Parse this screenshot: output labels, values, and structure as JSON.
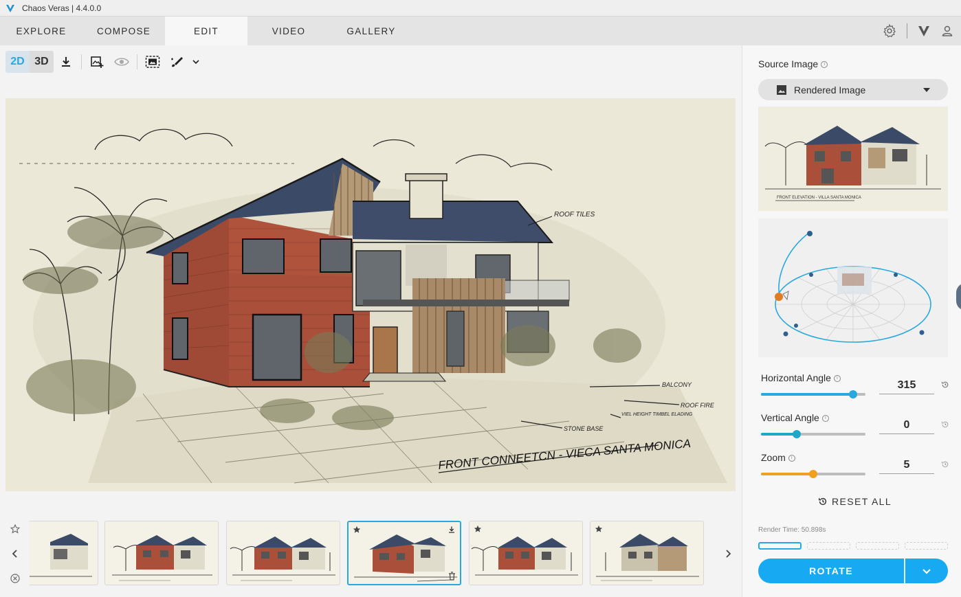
{
  "app": {
    "title": "Chaos Veras | 4.4.0.0"
  },
  "nav": {
    "tabs": [
      {
        "label": "EXPLORE"
      },
      {
        "label": "COMPOSE"
      },
      {
        "label": "EDIT",
        "active": true
      },
      {
        "label": "VIDEO"
      },
      {
        "label": "GALLERY"
      }
    ],
    "icons": [
      "gear-icon",
      "veras-logo-icon",
      "user-icon"
    ]
  },
  "toolbar": {
    "mode_2d": "2D",
    "mode_3d": "3D",
    "active_mode": "2D",
    "icons": [
      "download-icon",
      "add-image-icon",
      "eye-icon",
      "crop-image-icon",
      "brush-icon",
      "chevron-down-icon"
    ]
  },
  "canvas": {
    "annotations": {
      "roof_tiles": "ROOF TILES",
      "balcony": "BALCONY",
      "roof_fire": "ROOF FIRE",
      "stone_base": "STONE BASE",
      "vertical_timber": "VIEL HEIGHT TIMBEL ELADING",
      "caption": "FRONT CONNEETCN - VIECA SANTA MONICA"
    }
  },
  "thumbnails": {
    "count": 6,
    "selected_index": 3,
    "preview_caption": "FRONT ELEVATION - VILLA SANTA MONICA"
  },
  "panel": {
    "source_image_label": "Source Image",
    "source_image_value": "Rendered Image",
    "horizontal_angle": {
      "label": "Horizontal Angle",
      "value": "315",
      "fraction": 0.88
    },
    "vertical_angle": {
      "label": "Vertical Angle",
      "value": "0",
      "fraction": 0.34
    },
    "zoom": {
      "label": "Zoom",
      "value": "5",
      "fraction": 0.5
    },
    "reset_all": "RESET ALL",
    "render_time": "Render Time: 50.898s",
    "rotate_button": "ROTATE"
  },
  "colors": {
    "accent": "#17aaf2",
    "slider_blue": "#29a8df",
    "slider_orange": "#f0a020",
    "brick": "#a94f3a",
    "roof": "#3b4a66"
  }
}
